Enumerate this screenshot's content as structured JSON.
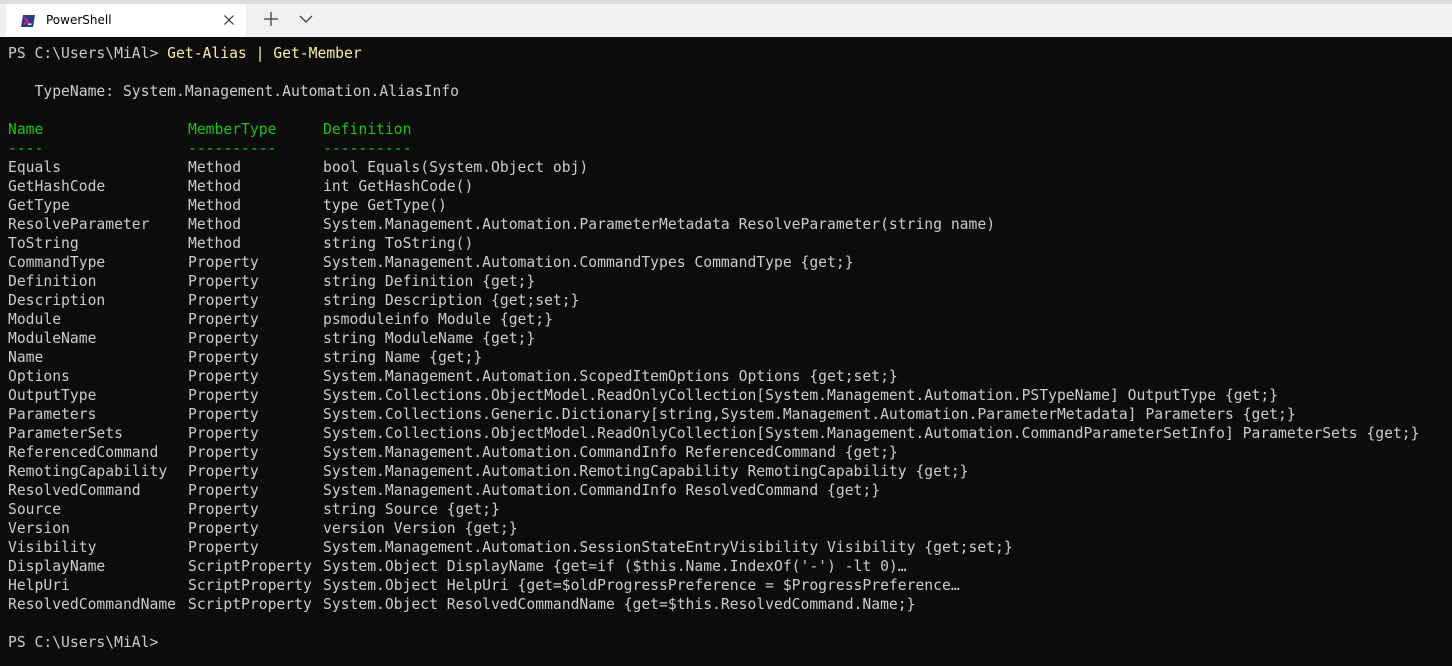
{
  "tab": {
    "title": "PowerShell",
    "icon": "powershell-icon"
  },
  "terminal": {
    "prompt": "PS C:\\Users\\MiAl> ",
    "command": "Get-Alias | Get-Member",
    "typename": "   TypeName: System.Management.Automation.AliasInfo",
    "headers": [
      "Name",
      "MemberType",
      "Definition"
    ],
    "separators": [
      "----",
      "----------",
      "----------"
    ],
    "rows": [
      [
        "Equals",
        "Method",
        "bool Equals(System.Object obj)"
      ],
      [
        "GetHashCode",
        "Method",
        "int GetHashCode()"
      ],
      [
        "GetType",
        "Method",
        "type GetType()"
      ],
      [
        "ResolveParameter",
        "Method",
        "System.Management.Automation.ParameterMetadata ResolveParameter(string name)"
      ],
      [
        "ToString",
        "Method",
        "string ToString()"
      ],
      [
        "CommandType",
        "Property",
        "System.Management.Automation.CommandTypes CommandType {get;}"
      ],
      [
        "Definition",
        "Property",
        "string Definition {get;}"
      ],
      [
        "Description",
        "Property",
        "string Description {get;set;}"
      ],
      [
        "Module",
        "Property",
        "psmoduleinfo Module {get;}"
      ],
      [
        "ModuleName",
        "Property",
        "string ModuleName {get;}"
      ],
      [
        "Name",
        "Property",
        "string Name {get;}"
      ],
      [
        "Options",
        "Property",
        "System.Management.Automation.ScopedItemOptions Options {get;set;}"
      ],
      [
        "OutputType",
        "Property",
        "System.Collections.ObjectModel.ReadOnlyCollection[System.Management.Automation.PSTypeName] OutputType {get;}"
      ],
      [
        "Parameters",
        "Property",
        "System.Collections.Generic.Dictionary[string,System.Management.Automation.ParameterMetadata] Parameters {get;}"
      ],
      [
        "ParameterSets",
        "Property",
        "System.Collections.ObjectModel.ReadOnlyCollection[System.Management.Automation.CommandParameterSetInfo] ParameterSets {get;}"
      ],
      [
        "ReferencedCommand",
        "Property",
        "System.Management.Automation.CommandInfo ReferencedCommand {get;}"
      ],
      [
        "RemotingCapability",
        "Property",
        "System.Management.Automation.RemotingCapability RemotingCapability {get;}"
      ],
      [
        "ResolvedCommand",
        "Property",
        "System.Management.Automation.CommandInfo ResolvedCommand {get;}"
      ],
      [
        "Source",
        "Property",
        "string Source {get;}"
      ],
      [
        "Version",
        "Property",
        "version Version {get;}"
      ],
      [
        "Visibility",
        "Property",
        "System.Management.Automation.SessionStateEntryVisibility Visibility {get;set;}"
      ],
      [
        "DisplayName",
        "ScriptProperty",
        "System.Object DisplayName {get=if ($this.Name.IndexOf('-') -lt 0)…"
      ],
      [
        "HelpUri",
        "ScriptProperty",
        "System.Object HelpUri {get=$oldProgressPreference = $ProgressPreference…"
      ],
      [
        "ResolvedCommandName",
        "ScriptProperty",
        "System.Object ResolvedCommandName {get=$this.ResolvedCommand.Name;}"
      ]
    ],
    "final_prompt": "PS C:\\Users\\MiAl>"
  },
  "colors": {
    "background": "#0c0c0c",
    "foreground": "#cccccc",
    "command": "#f9f1a5",
    "header": "#16c60c"
  }
}
